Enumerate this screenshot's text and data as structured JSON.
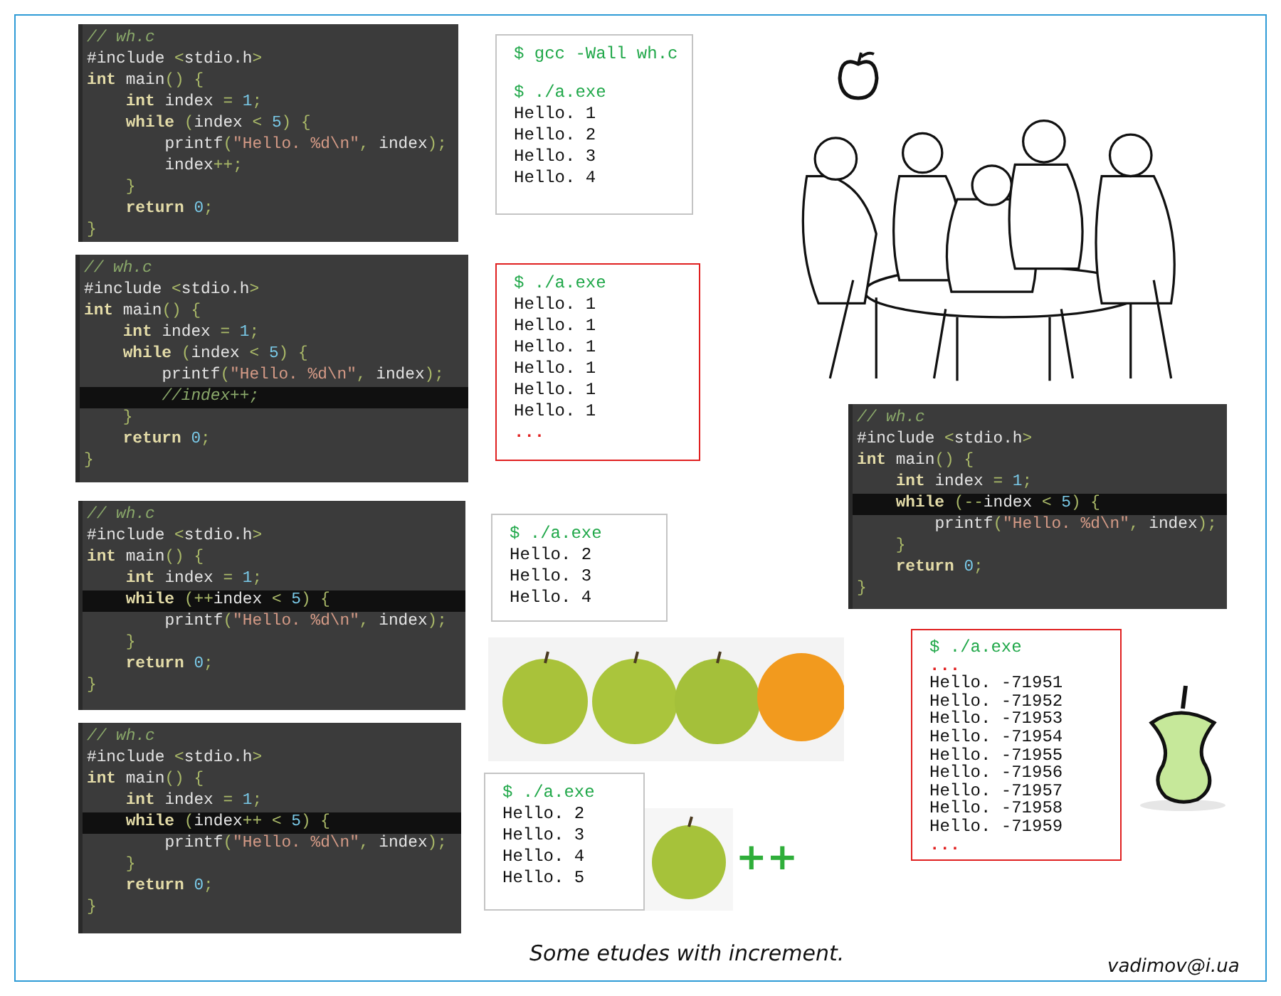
{
  "code_panels": [
    {
      "lines": [
        {
          "text": "// wh.c",
          "highlighted": false
        },
        {
          "text": "#include <stdio.h>",
          "highlighted": false
        },
        {
          "text": "int main() {",
          "highlighted": false
        },
        {
          "text": "    int index = 1;",
          "highlighted": false
        },
        {
          "text": "    while (index < 5) {",
          "highlighted": false
        },
        {
          "text": "        printf(\"Hello. %d\\n\", index);",
          "highlighted": false
        },
        {
          "text": "        index++;",
          "highlighted": false
        },
        {
          "text": "    }",
          "highlighted": false
        },
        {
          "text": "    return 0;",
          "highlighted": false
        },
        {
          "text": "}",
          "highlighted": false
        }
      ]
    },
    {
      "lines": [
        {
          "text": "// wh.c",
          "highlighted": false
        },
        {
          "text": "#include <stdio.h>",
          "highlighted": false
        },
        {
          "text": "int main() {",
          "highlighted": false
        },
        {
          "text": "    int index = 1;",
          "highlighted": false
        },
        {
          "text": "    while (index < 5) {",
          "highlighted": false
        },
        {
          "text": "        printf(\"Hello. %d\\n\", index);",
          "highlighted": false
        },
        {
          "text": "        //index++;",
          "highlighted": true
        },
        {
          "text": "    }",
          "highlighted": false
        },
        {
          "text": "    return 0;",
          "highlighted": false
        },
        {
          "text": "}",
          "highlighted": false
        }
      ]
    },
    {
      "lines": [
        {
          "text": "// wh.c",
          "highlighted": false
        },
        {
          "text": "#include <stdio.h>",
          "highlighted": false
        },
        {
          "text": "int main() {",
          "highlighted": false
        },
        {
          "text": "    int index = 1;",
          "highlighted": false
        },
        {
          "text": "    while (++index < 5) {",
          "highlighted": true
        },
        {
          "text": "        printf(\"Hello. %d\\n\", index);",
          "highlighted": false
        },
        {
          "text": "    }",
          "highlighted": false
        },
        {
          "text": "    return 0;",
          "highlighted": false
        },
        {
          "text": "}",
          "highlighted": false
        }
      ]
    },
    {
      "lines": [
        {
          "text": "// wh.c",
          "highlighted": false
        },
        {
          "text": "#include <stdio.h>",
          "highlighted": false
        },
        {
          "text": "int main() {",
          "highlighted": false
        },
        {
          "text": "    int index = 1;",
          "highlighted": false
        },
        {
          "text": "    while (index++ < 5) {",
          "highlighted": true
        },
        {
          "text": "        printf(\"Hello. %d\\n\", index);",
          "highlighted": false
        },
        {
          "text": "    }",
          "highlighted": false
        },
        {
          "text": "    return 0;",
          "highlighted": false
        },
        {
          "text": "}",
          "highlighted": false
        }
      ]
    },
    {
      "lines": [
        {
          "text": "// wh.c",
          "highlighted": false
        },
        {
          "text": "#include <stdio.h>",
          "highlighted": false
        },
        {
          "text": "int main() {",
          "highlighted": false
        },
        {
          "text": "    int index = 1;",
          "highlighted": false
        },
        {
          "text": "    while (--index < 5) {",
          "highlighted": true
        },
        {
          "text": "        printf(\"Hello. %d\\n\", index);",
          "highlighted": false
        },
        {
          "text": "    }",
          "highlighted": false
        },
        {
          "text": "    return 0;",
          "highlighted": false
        },
        {
          "text": "}",
          "highlighted": false
        }
      ]
    }
  ],
  "terminals": [
    {
      "alert": false,
      "lines": [
        {
          "kind": "prompt",
          "text": "$ gcc -Wall wh.c"
        },
        {
          "kind": "blank"
        },
        {
          "kind": "prompt",
          "text": "$ ./a.exe"
        },
        {
          "kind": "output",
          "text": "Hello. 1"
        },
        {
          "kind": "output",
          "text": "Hello. 2"
        },
        {
          "kind": "output",
          "text": "Hello. 3"
        },
        {
          "kind": "output",
          "text": "Hello. 4"
        }
      ]
    },
    {
      "alert": true,
      "lines": [
        {
          "kind": "prompt",
          "text": "$ ./a.exe"
        },
        {
          "kind": "output",
          "text": "Hello. 1"
        },
        {
          "kind": "output",
          "text": "Hello. 1"
        },
        {
          "kind": "output",
          "text": "Hello. 1"
        },
        {
          "kind": "output",
          "text": "Hello. 1"
        },
        {
          "kind": "output",
          "text": "Hello. 1"
        },
        {
          "kind": "output",
          "text": "Hello. 1"
        },
        {
          "kind": "ellipsis",
          "text": "..."
        }
      ]
    },
    {
      "alert": false,
      "lines": [
        {
          "kind": "prompt",
          "text": "$ ./a.exe"
        },
        {
          "kind": "output",
          "text": "Hello. 2"
        },
        {
          "kind": "output",
          "text": "Hello. 3"
        },
        {
          "kind": "output",
          "text": "Hello. 4"
        }
      ]
    },
    {
      "alert": false,
      "lines": [
        {
          "kind": "prompt",
          "text": "$ ./a.exe"
        },
        {
          "kind": "output",
          "text": "Hello. 2"
        },
        {
          "kind": "output",
          "text": "Hello. 3"
        },
        {
          "kind": "output",
          "text": "Hello. 4"
        },
        {
          "kind": "output",
          "text": "Hello. 5"
        }
      ]
    },
    {
      "alert": true,
      "lines": [
        {
          "kind": "prompt",
          "text": "$ ./a.exe"
        },
        {
          "kind": "ellipsis",
          "text": "..."
        },
        {
          "kind": "output",
          "text": "Hello. -71951"
        },
        {
          "kind": "output",
          "text": "Hello. -71952"
        },
        {
          "kind": "output",
          "text": "Hello. -71953"
        },
        {
          "kind": "output",
          "text": "Hello. -71954"
        },
        {
          "kind": "output",
          "text": "Hello. -71955"
        },
        {
          "kind": "output",
          "text": "Hello. -71956"
        },
        {
          "kind": "output",
          "text": "Hello. -71957"
        },
        {
          "kind": "output",
          "text": "Hello. -71958"
        },
        {
          "kind": "output",
          "text": "Hello. -71959"
        },
        {
          "kind": "ellipsis",
          "text": "..."
        }
      ]
    }
  ],
  "increment_sign": "++",
  "caption": "Some etudes with increment.",
  "author": "vadimov@i.ua"
}
